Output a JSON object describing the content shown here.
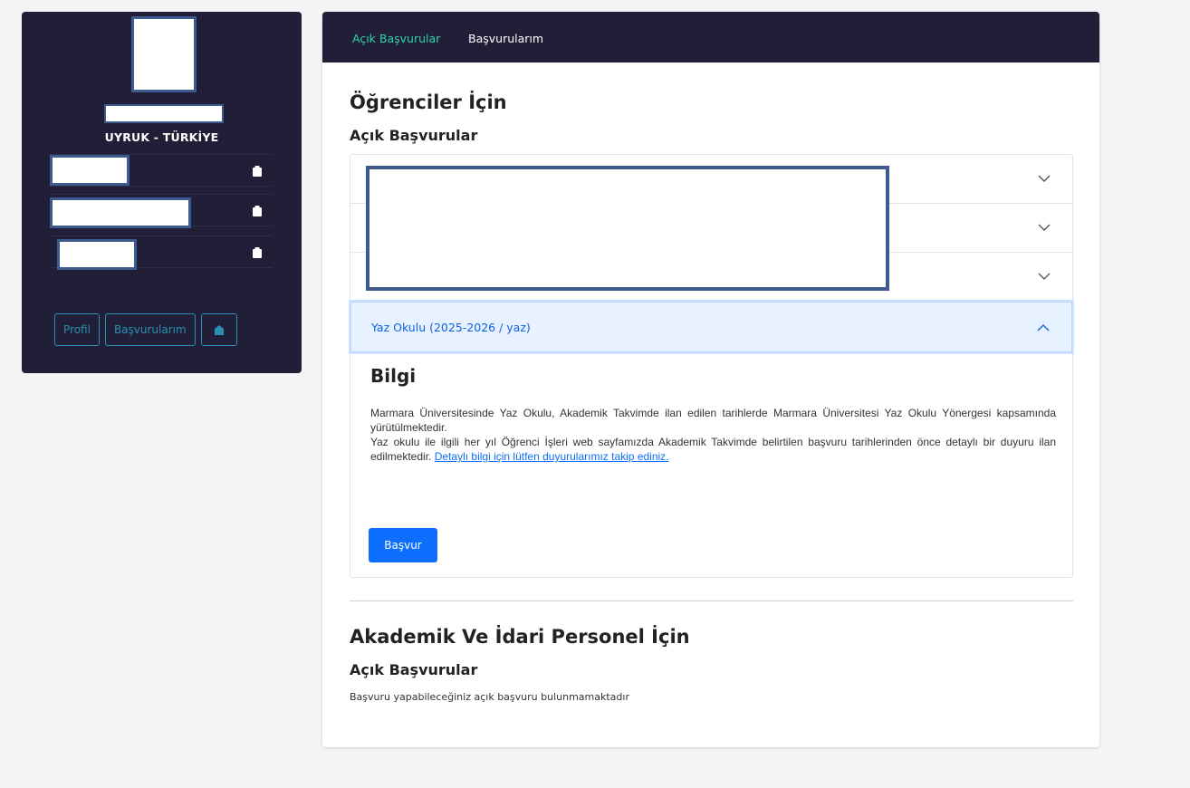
{
  "sidebar": {
    "nationality": "UYRUK - TÜRKİYE",
    "buttons": {
      "profile": "Profil",
      "applications": "Başvurularım"
    }
  },
  "nav": {
    "tabs": [
      {
        "label": "Açık Başvurular",
        "active": true
      },
      {
        "label": "Başvurularım",
        "active": false
      }
    ]
  },
  "students": {
    "heading": "Öğrenciler İçin",
    "subheading": "Açık Başvurular",
    "open_item": {
      "title": "Yaz Okulu (2025-2026 / yaz)",
      "info_heading": "Bilgi",
      "paragraph1": "Marmara Üniversitesinde Yaz Okulu, Akademik Takvimde ilan edilen tarihlerde Marmara Üniversitesi Yaz Okulu Yönergesi kapsamında yürütülmektedir.",
      "paragraph2": "Yaz okulu ile ilgili her yıl Öğrenci İşleri web sayfamızda Akademik Takvimde belirtilen başvuru tarihlerinden önce detaylı bir duyuru ilan edilmektedir.",
      "link": "Detaylı bilgi için lütfen duyurularımız takip ediniz.",
      "apply_button": "Başvur"
    }
  },
  "staff": {
    "heading": "Akademik Ve İdari Personel İçin",
    "subheading": "Açık Başvurular",
    "empty_message": "Başvuru yapabileceğiniz açık başvuru bulunmamaktadır"
  },
  "colors": {
    "dark": "#211f38",
    "accent_green": "#2fd3a8",
    "accent_blue": "#0d6efd",
    "outline_teal": "#2b8fb3"
  },
  "icons": {
    "copy": "clipboard-icon",
    "logout": "door-icon",
    "collapse": "chevron-down-icon",
    "expand": "chevron-up-icon"
  }
}
